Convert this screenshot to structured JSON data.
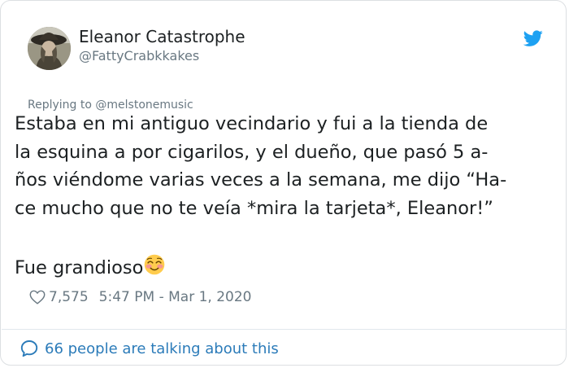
{
  "author": {
    "name": "Eleanor Catastrophe",
    "handle": "@FattyCrabkkakes"
  },
  "tweet": {
    "reply_prefix": "Replying to",
    "reply_to": "@melstonemusic",
    "lines": [
      "Estaba en mi antiguo vecindario y fui a la tienda de",
      "la esquina a por cigarilos, y el dueño, que pasó 5 a-",
      "ños viéndome varias veces a la semana, me dijo “Ha-",
      "ce mucho que no te veía *mira la tarjeta*, Eleanor!”"
    ],
    "followup": "Fue grandioso",
    "emoji": "smiling-face-with-smiling-eyes-icon"
  },
  "meta": {
    "likes": "7,575",
    "timestamp": "5:47 PM - Mar 1, 2020"
  },
  "footer": {
    "talking": "66 people are talking about this"
  },
  "colors": {
    "text": "#1c2022",
    "muted": "#697882",
    "link": "#2b7bb9",
    "twitter_blue": "#1da1f2",
    "border": "#dcdfe2"
  }
}
